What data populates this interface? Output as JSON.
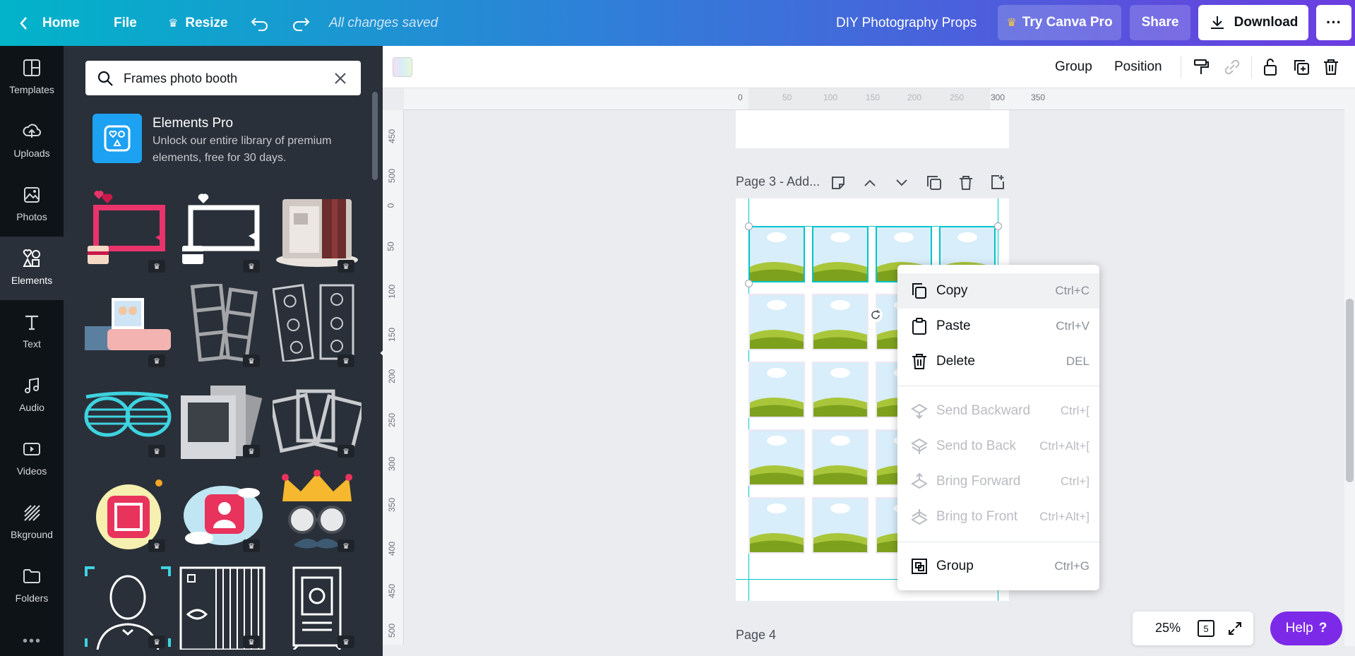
{
  "topbar": {
    "home_label": "Home",
    "file_label": "File",
    "resize_label": "Resize",
    "save_status": "All changes saved",
    "design_title": "DIY Photography Props",
    "try_pro_label": "Try Canva Pro",
    "share_label": "Share",
    "download_label": "Download",
    "more_label": "···",
    "brand_color": "#7d2ae8"
  },
  "sidebar": {
    "items": [
      {
        "label": "Templates",
        "icon": "templates-icon"
      },
      {
        "label": "Uploads",
        "icon": "upload-icon"
      },
      {
        "label": "Photos",
        "icon": "photo-icon"
      },
      {
        "label": "Elements",
        "icon": "elements-icon",
        "active": true
      },
      {
        "label": "Text",
        "icon": "text-icon"
      },
      {
        "label": "Audio",
        "icon": "audio-icon"
      },
      {
        "label": "Videos",
        "icon": "video-icon"
      },
      {
        "label": "Bkground",
        "icon": "background-icon"
      },
      {
        "label": "Folders",
        "icon": "folder-icon"
      }
    ]
  },
  "panel": {
    "search_value": "Frames photo booth",
    "promo_title": "Elements Pro",
    "promo_line1": "Unlock our entire library of premium",
    "promo_line2": "elements, free for 30 days."
  },
  "toolbar": {
    "group_label": "Group",
    "position_label": "Position"
  },
  "ruler": {
    "top_ticks": [
      "0",
      "50",
      "100",
      "150",
      "200",
      "250",
      "300",
      "350"
    ],
    "left_ticks": [
      "450",
      "500",
      "0",
      "50",
      "100",
      "150",
      "200",
      "250",
      "300",
      "350",
      "400",
      "450",
      "500"
    ]
  },
  "canvas": {
    "page3_label": "Page 3 - Add...",
    "page4_label": "Page 4",
    "selection_color": "#00c4cc"
  },
  "context_menu": {
    "items": [
      {
        "label": "Copy",
        "shortcut": "Ctrl+C",
        "icon": "copy-icon",
        "enabled": true
      },
      {
        "label": "Paste",
        "shortcut": "Ctrl+V",
        "icon": "paste-icon",
        "enabled": true
      },
      {
        "label": "Delete",
        "shortcut": "DEL",
        "icon": "trash-icon",
        "enabled": true
      },
      {
        "label": "Send Backward",
        "shortcut": "Ctrl+[",
        "icon": "send-backward-icon",
        "enabled": false
      },
      {
        "label": "Send to Back",
        "shortcut": "Ctrl+Alt+[",
        "icon": "send-to-back-icon",
        "enabled": false
      },
      {
        "label": "Bring Forward",
        "shortcut": "Ctrl+]",
        "icon": "bring-forward-icon",
        "enabled": false
      },
      {
        "label": "Bring to Front",
        "shortcut": "Ctrl+Alt+]",
        "icon": "bring-to-front-icon",
        "enabled": false
      },
      {
        "label": "Group",
        "shortcut": "Ctrl+G",
        "icon": "group-icon",
        "enabled": true
      }
    ]
  },
  "bottom": {
    "zoom": "25%",
    "page_count": "5",
    "help_label": "Help",
    "help_symbol": "?"
  }
}
